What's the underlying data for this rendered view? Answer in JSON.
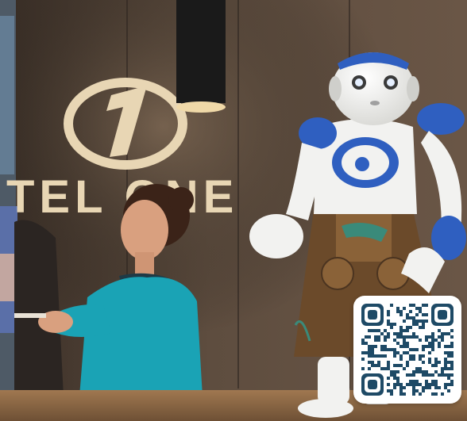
{
  "sign": {
    "logo_numeral": "1",
    "wall_text": "TEL ONE"
  },
  "colors": {
    "wall": "#5a4a3c",
    "sign": "#e8d6b4",
    "robot_white": "#f2f2f0",
    "robot_blue": "#2f5fc0",
    "receptionist_top": "#1aa3b5",
    "lederhosen": "#6b4a2a",
    "qr_dark": "#1e4a66"
  },
  "qr_code": {
    "icon": "qr-code-icon"
  }
}
